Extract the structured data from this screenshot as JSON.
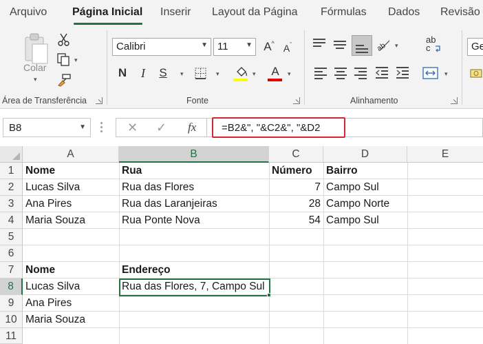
{
  "ribbon_tabs": [
    "Arquivo",
    "Página Inicial",
    "Inserir",
    "Layout da Página",
    "Fórmulas",
    "Dados",
    "Revisão"
  ],
  "active_tab": "Página Inicial",
  "clipboard": {
    "paste_label": "Colar",
    "group_label": "Área de Transferência"
  },
  "font": {
    "name": "Calibri",
    "size": "11",
    "group_label": "Fonte",
    "bold_label": "N",
    "italic_label": "I",
    "underline_label": "S",
    "grow_label": "A",
    "shrink_label": "A",
    "color_label": "A",
    "fill_color": "#ffff00",
    "font_color": "#e00000"
  },
  "alignment": {
    "group_label": "Alinhamento",
    "wrap_label": "ab\nc"
  },
  "number": {
    "format_partial": "Ge"
  },
  "formula_bar": {
    "name_box": "B8",
    "cancel_glyph": "✕",
    "enter_glyph": "✓",
    "fx_label": "fx",
    "formula": "=B2&\", \"&C2&\", \"&D2",
    "highlight_color": "#d4262e"
  },
  "columns": [
    "A",
    "B",
    "C",
    "D",
    "E"
  ],
  "rows": [
    "1",
    "2",
    "3",
    "4",
    "5",
    "6",
    "7",
    "8",
    "9",
    "10",
    "11"
  ],
  "selected": {
    "column": "B",
    "row": "8",
    "accent": "#217346"
  },
  "cells": {
    "A1": "Nome",
    "B1": "Rua",
    "C1": "Número",
    "D1": "Bairro",
    "A2": "Lucas Silva",
    "B2": "Rua das Flores",
    "C2": "7",
    "D2": "Campo Sul",
    "A3": "Ana Pires",
    "B3": "Rua das Laranjeiras",
    "C3": "28",
    "D3": "Campo Norte",
    "A4": "Maria Souza",
    "B4": "Rua Ponte Nova",
    "C4": "54",
    "D4": "Campo Sul",
    "A7": "Nome",
    "B7": "Endereço",
    "A8": "Lucas Silva",
    "B8": "Rua das Flores, 7, Campo Sul",
    "A9": "Ana Pires",
    "A10": "Maria Souza"
  }
}
